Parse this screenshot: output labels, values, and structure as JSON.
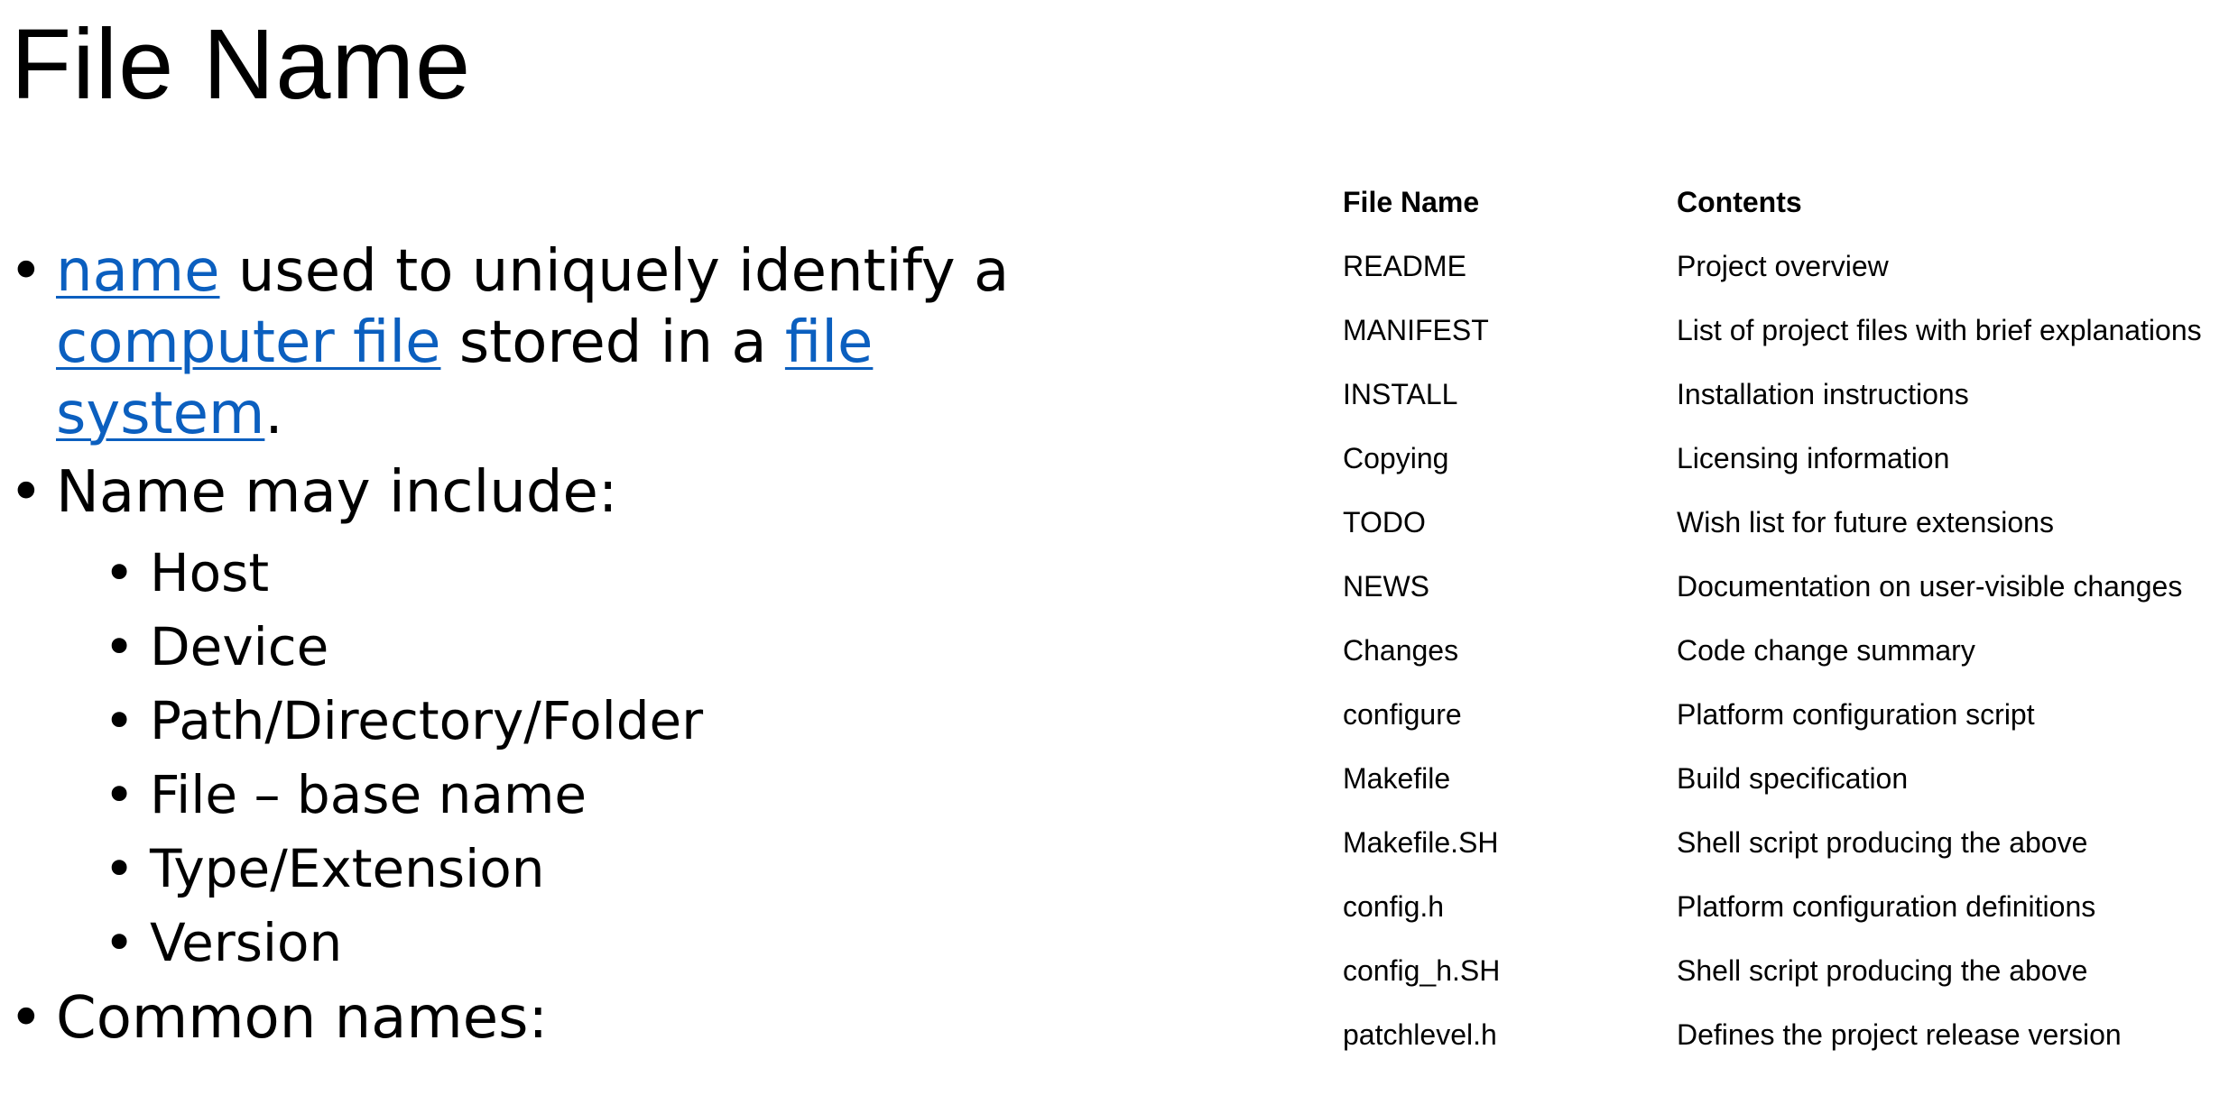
{
  "slide": {
    "title": "File Name",
    "bullets": {
      "b1": {
        "link_name": "name",
        "text1": " used to uniquely identify a ",
        "link_computer_file": "computer file",
        "text2": " stored in a ",
        "link_file_system": "file system",
        "text3": "."
      },
      "b2": {
        "text": "Name may include:",
        "items": [
          "Host",
          "Device",
          "Path/Directory/Folder",
          "File – base name",
          "Type/Extension",
          "Version"
        ]
      },
      "b3": {
        "text": "Common names:"
      }
    },
    "bullet_char": "•"
  },
  "table": {
    "headers": {
      "name": "File Name",
      "contents": "Contents"
    },
    "rows": [
      {
        "name": "README",
        "contents": "Project overview"
      },
      {
        "name": "MANIFEST",
        "contents": "List of project files with brief explanations"
      },
      {
        "name": "INSTALL",
        "contents": "Installation instructions"
      },
      {
        "name": "Copying",
        "contents": "Licensing information"
      },
      {
        "name": "TODO",
        "contents": "Wish list for future extensions"
      },
      {
        "name": "NEWS",
        "contents": "Documentation on user-visible changes"
      },
      {
        "name": "Changes",
        "contents": "Code change summary"
      },
      {
        "name": "configure",
        "contents": "Platform configuration script"
      },
      {
        "name": "Makefile",
        "contents": "Build specification"
      },
      {
        "name": "Makefile.SH",
        "contents": "Shell script producing the above"
      },
      {
        "name": "config.h",
        "contents": "Platform configuration definitions"
      },
      {
        "name": "config_h.SH",
        "contents": "Shell script producing the above"
      },
      {
        "name": "patchlevel.h",
        "contents": "Defines the project release version"
      }
    ]
  },
  "colors": {
    "link": "#0b5fbf",
    "text": "#000000",
    "background": "#ffffff"
  }
}
